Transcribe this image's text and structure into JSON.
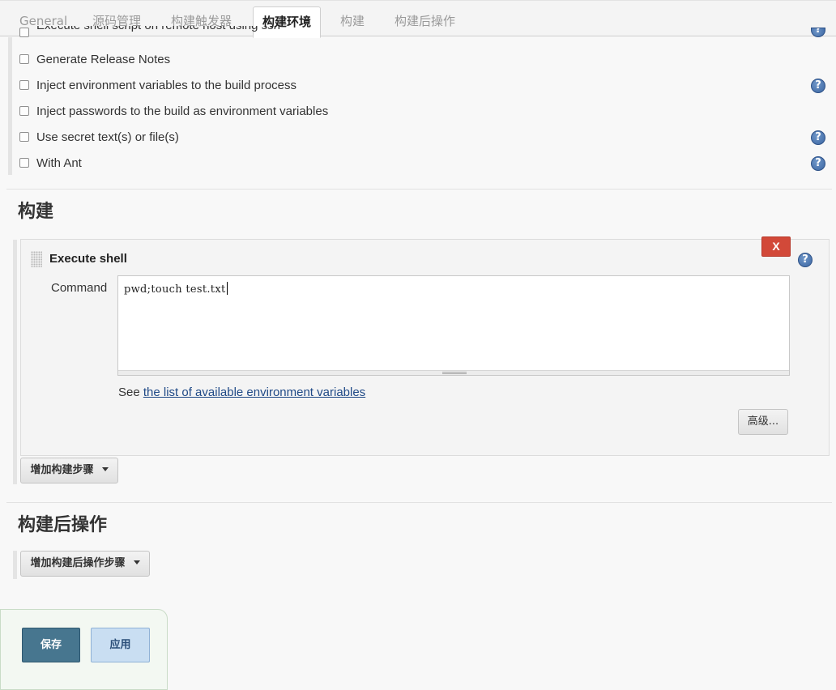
{
  "tabs": [
    {
      "label": "General"
    },
    {
      "label": "源码管理"
    },
    {
      "label": "构建触发器"
    },
    {
      "label": "构建环境"
    },
    {
      "label": "构建"
    },
    {
      "label": "构建后操作"
    }
  ],
  "build_env": {
    "partial_item": "Execute shell script on remote host using ssh",
    "items": [
      {
        "label": "Generate Release Notes",
        "checked": false
      },
      {
        "label": "Inject environment variables to the build process",
        "checked": false
      },
      {
        "label": "Inject passwords to the build as environment variables",
        "checked": false
      },
      {
        "label": "Use secret text(s) or file(s)",
        "checked": false
      },
      {
        "label": "With Ant",
        "checked": false
      }
    ]
  },
  "build": {
    "title": "构建",
    "step": {
      "title": "Execute shell",
      "delete_label": "X",
      "command_label": "Command",
      "command_value": "pwd;touch test.txt",
      "see_prefix": "See ",
      "see_link": "the list of available environment variables",
      "advanced_label": "高级..."
    },
    "add_step_label": "增加构建步骤"
  },
  "post_build": {
    "title": "构建后操作",
    "add_step_label": "增加构建后操作步骤"
  },
  "actions": {
    "save_label": "保存",
    "apply_label": "应用"
  },
  "help_glyph": "?"
}
